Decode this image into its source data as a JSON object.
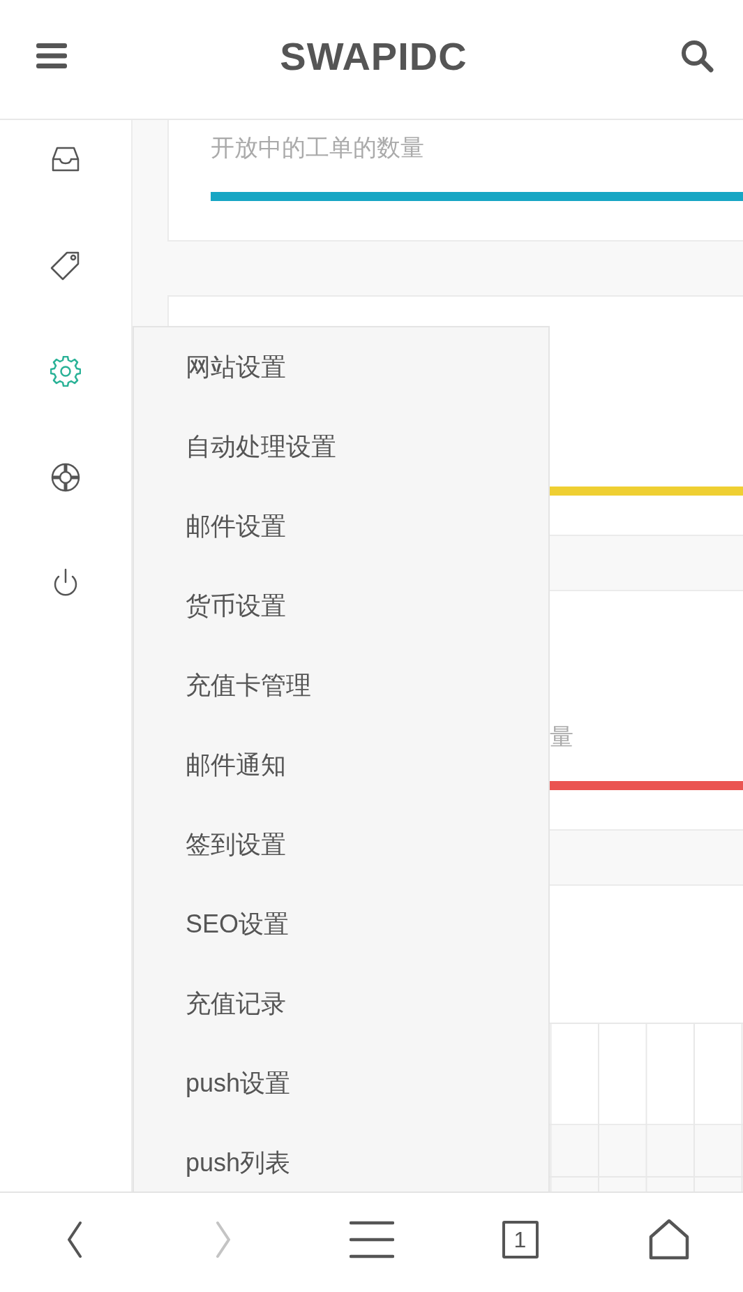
{
  "header": {
    "title": "SWAPIDC"
  },
  "sidebar": {
    "items": [
      {
        "kind": "inbox",
        "selected": false
      },
      {
        "kind": "tag",
        "selected": false
      },
      {
        "kind": "gear",
        "selected": true
      },
      {
        "kind": "lifebuoy",
        "selected": false
      },
      {
        "kind": "power",
        "selected": false
      }
    ]
  },
  "cards": [
    {
      "kind": "stat",
      "label": "开放中的工单的数量",
      "color": "#17a6c4"
    },
    {
      "kind": "stat",
      "color": "#efcf32"
    },
    {
      "kind": "stat",
      "label": "量",
      "color": "#ea5451"
    },
    {
      "kind": "table"
    }
  ],
  "menu": {
    "items": [
      "网站设置",
      "自动处理设置",
      "邮件设置",
      "货币设置",
      "充值卡管理",
      "邮件通知",
      "签到设置",
      "SEO设置",
      "充值记录",
      "push设置",
      "push列表"
    ]
  },
  "browser_bar": {
    "buttons": [
      {
        "kind": "back",
        "disabled": false
      },
      {
        "kind": "forward",
        "disabled": true
      },
      {
        "kind": "menu",
        "disabled": false
      },
      {
        "kind": "tabs",
        "label": "1",
        "disabled": false
      },
      {
        "kind": "home",
        "disabled": false
      }
    ]
  }
}
